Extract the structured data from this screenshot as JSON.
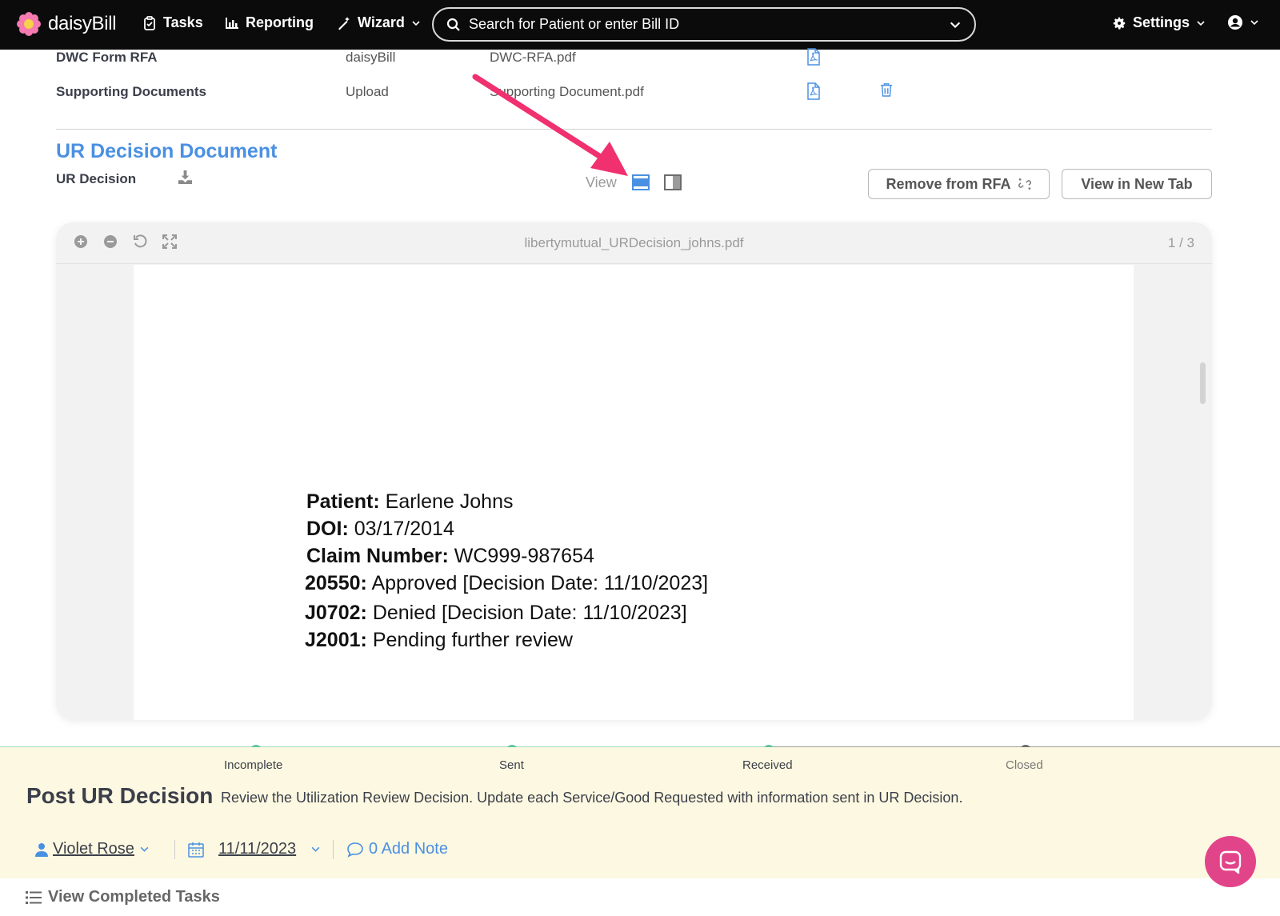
{
  "nav": {
    "brand": "daisyBill",
    "tasks": "Tasks",
    "reporting": "Reporting",
    "wizard": "Wizard",
    "search_placeholder": "Search for Patient or enter Bill ID",
    "settings": "Settings"
  },
  "attachments": [
    {
      "name": "DWC Form RFA",
      "source": "daisyBill",
      "file": "DWC-RFA.pdf"
    },
    {
      "name": "Supporting Documents",
      "source": "Upload",
      "file": "Supporting Document.pdf"
    }
  ],
  "ur_section": {
    "title": "UR Decision Document",
    "label": "UR Decision",
    "view_label": "View",
    "remove_button": "Remove from RFA",
    "new_tab_button": "View in New Tab"
  },
  "viewer": {
    "file_name": "libertymutual_URDecision_johns.pdf",
    "page_count": "1 / 3",
    "lines": [
      {
        "label": "Patient:",
        "value": "Earlene Johns"
      },
      {
        "label": "DOI:",
        "value": "03/17/2014"
      },
      {
        "label": "Claim Number:",
        "value": "WC999-987654"
      },
      {
        "label": "20550:",
        "value": "Approved [Decision Date: 11/10/2023]"
      },
      {
        "label": "J0702:",
        "value": "Denied [Decision Date: 11/10/2023]"
      },
      {
        "label": "J2001:",
        "value": "Pending further review"
      }
    ]
  },
  "progress": {
    "steps": [
      "Incomplete",
      "Sent",
      "Received",
      "Closed"
    ],
    "colors": {
      "done": "#5ec4a0",
      "pending": "#9e9e9e"
    }
  },
  "task": {
    "title": "Post UR Decision",
    "description": "Review the Utilization Review Decision. Update each Service/Good Requested with information sent in UR Decision.",
    "assignee": "Violet Rose",
    "date": "11/11/2023",
    "notes": "0 Add Note"
  },
  "footer": {
    "completed_tasks": "View Completed Tasks"
  },
  "colors": {
    "accent_blue": "#4a90e2",
    "arrow_pink": "#f0306f",
    "chat_pink": "#e2448a",
    "task_bg": "#fdf8e1"
  }
}
